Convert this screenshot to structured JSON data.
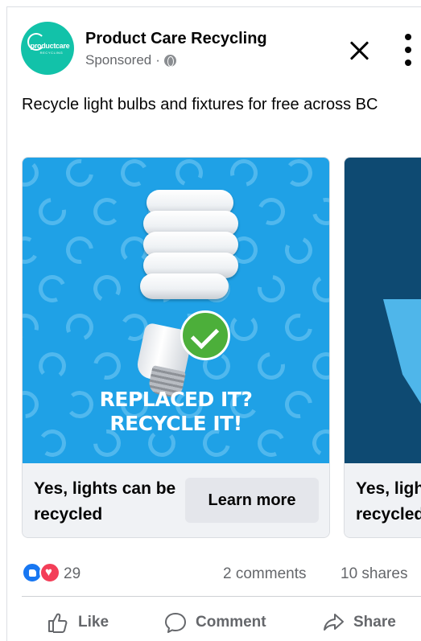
{
  "post": {
    "page_name": "Product Care Recycling",
    "sponsored_label": "Sponsored",
    "separator": "·",
    "avatar_logo_text": "productcare",
    "avatar_logo_sub": "RECYCLING",
    "text": "Recycle light bulbs and fixtures for free across BC",
    "brand_color": "#12c2a9"
  },
  "carousel": {
    "cards": [
      {
        "image_headline_line1": "REPLACED IT?",
        "image_headline_line2": "RECYCLE IT!",
        "title": "Yes, lights can be recycled",
        "cta": "Learn more",
        "image_bg": "#1fa1e6"
      },
      {
        "title": "Yes, lights can be recycled",
        "image_bg": "#0e4a72"
      }
    ]
  },
  "stats": {
    "reaction_count": "29",
    "comments": "2 comments",
    "shares": "10 shares",
    "reaction_icons": [
      "like-icon",
      "love-icon"
    ]
  },
  "actions": {
    "like": "Like",
    "comment": "Comment",
    "share": "Share"
  },
  "colors": {
    "accent": "#1877f2",
    "love": "#f33e58",
    "secondary_text": "#65676b"
  }
}
